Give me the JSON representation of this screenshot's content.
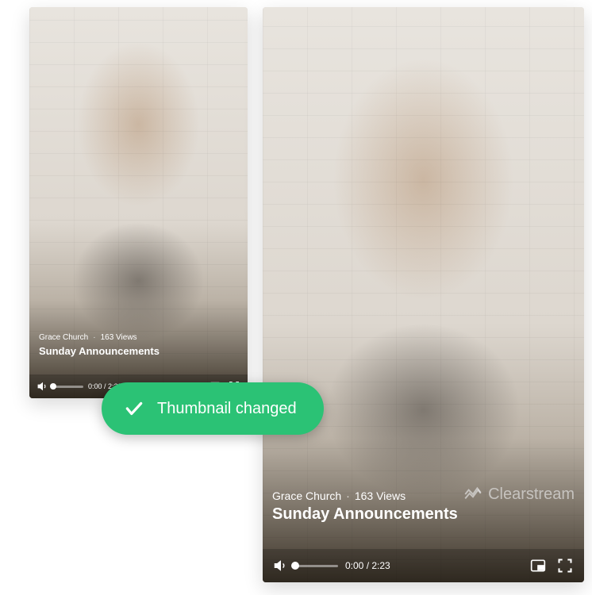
{
  "video": {
    "channel": "Grace Church",
    "views": "163 Views",
    "separator": "·",
    "title": "Sunday Announcements",
    "current_time": "0:00",
    "duration": "2:23",
    "time_display": "0:00 / 2:23",
    "brand": "Clearstream"
  },
  "toast": {
    "message": "Thumbnail changed"
  }
}
